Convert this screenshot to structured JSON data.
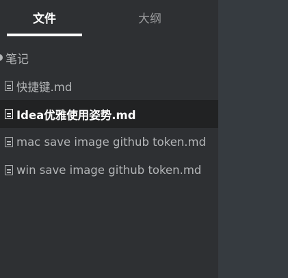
{
  "sidebar": {
    "tabs": {
      "files_label": "文件",
      "outline_label": "大纲"
    },
    "folder": {
      "label": "笔记"
    },
    "files": [
      {
        "label": "快捷键.md",
        "icon": "file-icon"
      },
      {
        "label": "Idea优雅使用姿势.md",
        "icon": "file-icon",
        "active": true
      },
      {
        "label": "mac save image github token.md",
        "icon": "file-icon"
      },
      {
        "label": "win save image github token.md",
        "icon": "file-icon"
      }
    ]
  },
  "colors": {
    "sidebar_bg": "#2e3033",
    "editor_bg": "#363b40",
    "active_row_bg": "#212223",
    "text_muted": "#b4b6b8",
    "text_active": "#ffffff"
  }
}
